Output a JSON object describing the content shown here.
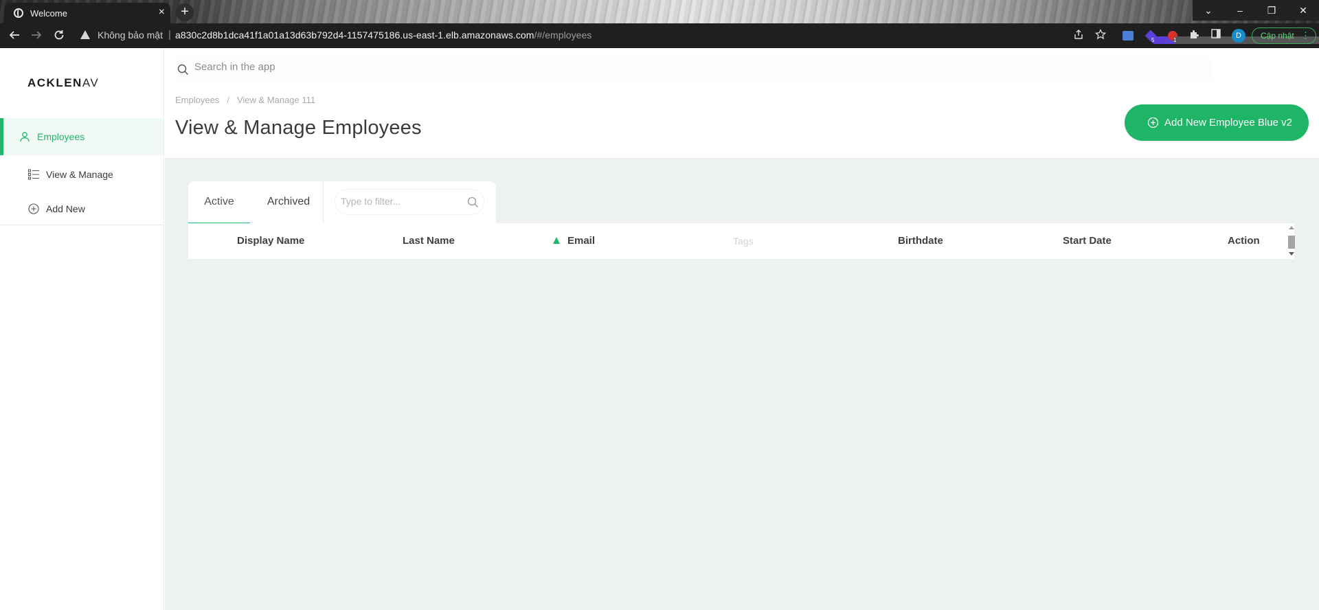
{
  "browser": {
    "tab_title": "Welcome",
    "tab_close": "×",
    "new_tab": "+",
    "security_label": "Không bảo mật",
    "url_host": "a830c2d8b1dca41f1a01a13d63b792d4-1157475186.us-east-1.elb.amazonaws.com",
    "url_path": "/#/employees",
    "profile_initial": "D",
    "update_label": "Cập nhật",
    "extension_badges": [
      "5",
      "1"
    ],
    "window_controls": [
      "⌄",
      "–",
      "❐",
      "✕"
    ]
  },
  "sidebar": {
    "logo": "ACKLEN",
    "logo_tail": "AV",
    "items": [
      {
        "label": "Employees",
        "icon": "user-icon",
        "active": true
      },
      {
        "label": "View & Manage",
        "icon": "list-icon",
        "active": false
      },
      {
        "label": "Add New",
        "icon": "plus-circle-icon",
        "active": false
      }
    ]
  },
  "topbar": {
    "search_placeholder": "Search in the app"
  },
  "header": {
    "breadcrumb": [
      "Employees",
      "View & Manage 111"
    ],
    "breadcrumb_sep": "/",
    "title": "View & Manage Employees",
    "add_button": "Add New Employee Blue v2"
  },
  "tabs": {
    "items": [
      "Active",
      "Archived"
    ],
    "active": "Active",
    "filter_placeholder": "Type to filter..."
  },
  "table": {
    "columns": [
      "Display Name",
      "Last Name",
      "Email",
      "Tags",
      "Birthdate",
      "Start Date",
      "Action"
    ],
    "sorted_column": "Email",
    "sort_direction": "ascending",
    "rows": []
  },
  "colors": {
    "accent": "#1eb567",
    "content_bg": "#eef1f1"
  }
}
